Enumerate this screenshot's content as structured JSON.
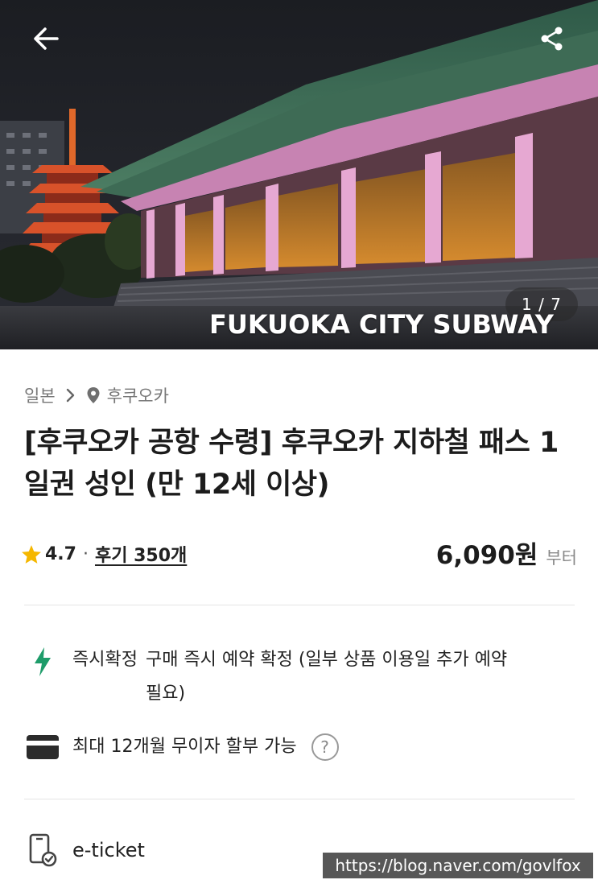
{
  "hero": {
    "image_counter": "1 / 7",
    "overlay_text": "FUKUOKA CITY SUBWAY",
    "back_icon": "arrow-left-icon",
    "share_icon": "share-icon"
  },
  "breadcrumb": {
    "country": "일본",
    "city": "후쿠오카"
  },
  "title": "[후쿠오카 공항 수령] 후쿠오카 지하철 패스 1일권 성인 (만 12세 이상)",
  "rating": {
    "score": "4.7",
    "separator": "·",
    "reviews": "후기 350개"
  },
  "price": {
    "amount": "6,090원",
    "suffix": "부터"
  },
  "features": {
    "instant": {
      "label": "즉시확정",
      "description": "구매 즉시 예약 확정 (일부 상품 이용일 추가 예약 필요)"
    },
    "installment": {
      "label": "최대 12개월 무이자 할부 가능",
      "help": "?"
    },
    "ticket": {
      "label": "e-ticket"
    }
  },
  "watermark": "https://blog.naver.com/govlfox",
  "colors": {
    "accent_green": "#1e9c6a",
    "text_dark": "#1c1c1c",
    "text_muted": "#777777",
    "star": "#f5b700"
  }
}
